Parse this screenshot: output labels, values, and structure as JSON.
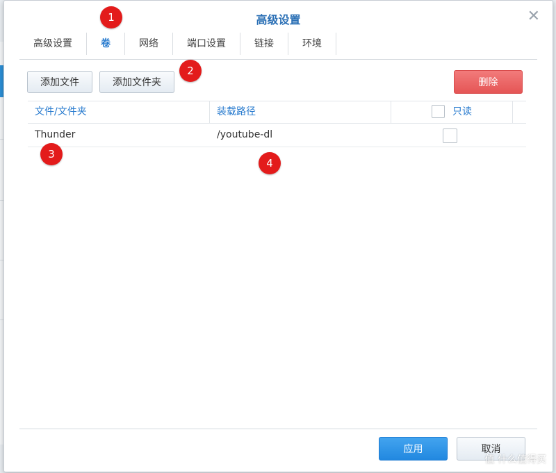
{
  "dialog": {
    "title": "高级设置",
    "close_glyph": "✕"
  },
  "tabs": [
    {
      "label": "高级设置",
      "active": false
    },
    {
      "label": "卷",
      "active": true
    },
    {
      "label": "网络",
      "active": false
    },
    {
      "label": "端口设置",
      "active": false
    },
    {
      "label": "链接",
      "active": false
    },
    {
      "label": "环境",
      "active": false
    }
  ],
  "toolbar": {
    "add_file": "添加文件",
    "add_folder": "添加文件夹",
    "delete": "删除"
  },
  "table": {
    "headers": {
      "file_folder": "文件/文件夹",
      "mount_path": "装载路径",
      "readonly": "只读"
    },
    "rows": [
      {
        "file_folder": "Thunder",
        "mount_path": "/youtube-dl",
        "readonly": false
      }
    ]
  },
  "annotations": [
    "1",
    "2",
    "3",
    "4"
  ],
  "footer": {
    "apply": "应用",
    "cancel": "取消"
  },
  "watermark": "值 什么值得买",
  "colors": {
    "accent": "#2a7ccf",
    "danger": "#e55555",
    "primary": "#2188e0",
    "badge": "#e31b1b"
  }
}
